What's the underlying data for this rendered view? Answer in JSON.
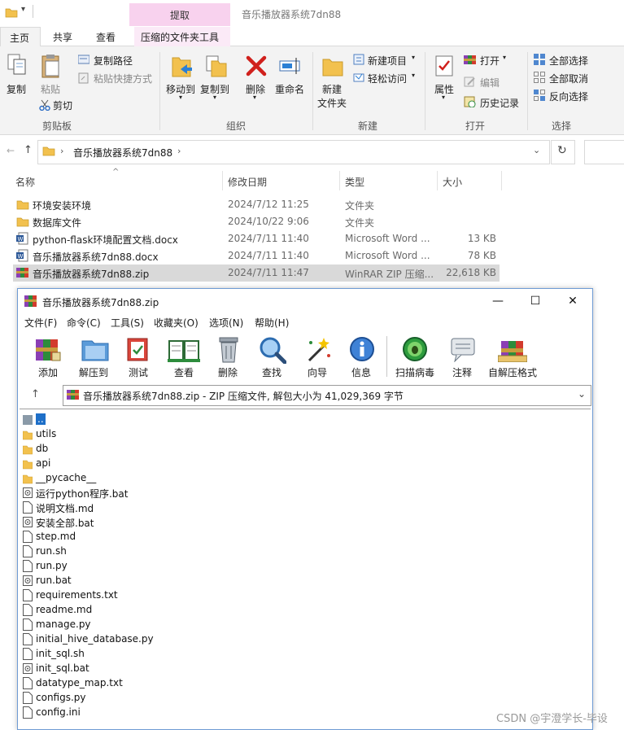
{
  "explorer": {
    "window_title": "音乐播放器系统7dn88",
    "extract_tab": "提取",
    "tabs": [
      "主页",
      "共享",
      "查看",
      "压缩的文件夹工具"
    ],
    "ribbon": {
      "clipboard": {
        "group": "剪贴板",
        "copy": "复制",
        "paste": "粘贴",
        "copy_path": "复制路径",
        "paste_shortcut": "粘贴快捷方式",
        "cut": "剪切"
      },
      "organize": {
        "group": "组织",
        "move_to": "移动到",
        "copy_to": "复制到",
        "delete": "删除",
        "rename": "重命名"
      },
      "new": {
        "group": "新建",
        "new_folder_line1": "新建",
        "new_folder_line2": "文件夹",
        "new_item": "新建项目",
        "easy_access": "轻松访问"
      },
      "open": {
        "group": "打开",
        "properties": "属性",
        "open": "打开",
        "edit": "编辑",
        "history": "历史记录"
      },
      "select": {
        "group": "选择",
        "select_all": "全部选择",
        "select_none": "全部取消",
        "invert": "反向选择"
      }
    },
    "address": "音乐播放器系统7dn88",
    "columns": [
      "名称",
      "修改日期",
      "类型",
      "大小"
    ],
    "files": [
      {
        "name": "环境安装环境",
        "date": "2024/7/12 11:25",
        "type": "文件夹",
        "size": ""
      },
      {
        "name": "数据库文件",
        "date": "2024/10/22 9:06",
        "type": "文件夹",
        "size": ""
      },
      {
        "name": "python-flask环境配置文档.docx",
        "date": "2024/7/11 11:40",
        "type": "Microsoft Word ...",
        "size": "13 KB"
      },
      {
        "name": "音乐播放器系统7dn88.docx",
        "date": "2024/7/11 11:40",
        "type": "Microsoft Word ...",
        "size": "78 KB"
      },
      {
        "name": "音乐播放器系统7dn88.zip",
        "date": "2024/7/11 11:47",
        "type": "WinRAR ZIP 压缩...",
        "size": "22,618 KB"
      }
    ]
  },
  "winrar": {
    "title": "音乐播放器系统7dn88.zip",
    "menu": [
      "文件(F)",
      "命令(C)",
      "工具(S)",
      "收藏夹(O)",
      "选项(N)",
      "帮助(H)"
    ],
    "toolbar": [
      "添加",
      "解压到",
      "测试",
      "查看",
      "删除",
      "查找",
      "向导",
      "信息",
      "扫描病毒",
      "注释",
      "自解压格式"
    ],
    "path": "音乐播放器系统7dn88.zip - ZIP 压缩文件, 解包大小为 41,029,369 字节",
    "items": [
      {
        "name": "..",
        "kind": "up"
      },
      {
        "name": "utils",
        "kind": "folder"
      },
      {
        "name": "db",
        "kind": "folder"
      },
      {
        "name": "api",
        "kind": "folder"
      },
      {
        "name": "__pycache__",
        "kind": "folder"
      },
      {
        "name": "运行python程序.bat",
        "kind": "bat"
      },
      {
        "name": "说明文档.md",
        "kind": "file"
      },
      {
        "name": "安装全部.bat",
        "kind": "bat"
      },
      {
        "name": "step.md",
        "kind": "file"
      },
      {
        "name": "run.sh",
        "kind": "file"
      },
      {
        "name": "run.py",
        "kind": "file"
      },
      {
        "name": "run.bat",
        "kind": "bat"
      },
      {
        "name": "requirements.txt",
        "kind": "file"
      },
      {
        "name": "readme.md",
        "kind": "file"
      },
      {
        "name": "manage.py",
        "kind": "file"
      },
      {
        "name": "initial_hive_database.py",
        "kind": "file"
      },
      {
        "name": "init_sql.sh",
        "kind": "file"
      },
      {
        "name": "init_sql.bat",
        "kind": "bat"
      },
      {
        "name": "datatype_map.txt",
        "kind": "file"
      },
      {
        "name": "configs.py",
        "kind": "file"
      },
      {
        "name": "config.ini",
        "kind": "file"
      }
    ]
  },
  "watermark": "CSDN @宇澄学长-毕设",
  "colors": {
    "extract_tab": "#f8d2ee",
    "folder": "#f2c14e",
    "selected_row": "#d9d9d9",
    "accent": "#1e6fc8"
  }
}
